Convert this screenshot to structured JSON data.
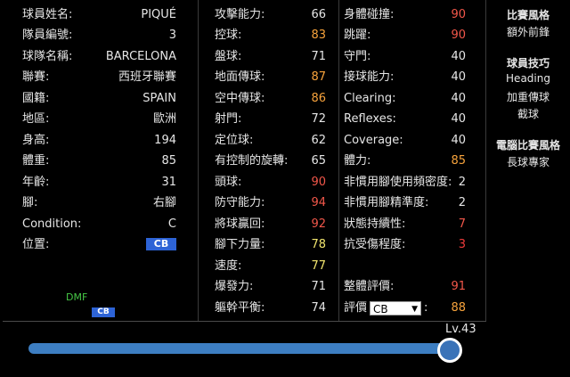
{
  "info": [
    {
      "label": "球員姓名:",
      "value": "PIQUÉ"
    },
    {
      "label": "隊員編號:",
      "value": "3"
    },
    {
      "label": "球隊名稱:",
      "value": "BARCELONA"
    },
    {
      "label": "聯賽:",
      "value": "西班牙聯賽"
    },
    {
      "label": "國籍:",
      "value": "SPAIN"
    },
    {
      "label": "地區:",
      "value": "歐洲"
    },
    {
      "label": "身高:",
      "value": "194"
    },
    {
      "label": "體重:",
      "value": "85"
    },
    {
      "label": "年齡:",
      "value": "31"
    },
    {
      "label": "腳:",
      "value": "右腳"
    },
    {
      "label": "Condition:",
      "value": "C"
    }
  ],
  "position": {
    "label": "位置:",
    "value": "CB"
  },
  "mini_positions": {
    "dmf": "DMF",
    "cb": "CB"
  },
  "stats_mid": [
    {
      "label": "攻擊能力:",
      "value": "66"
    },
    {
      "label": "控球:",
      "value": "83"
    },
    {
      "label": "盤球:",
      "value": "71"
    },
    {
      "label": "地面傳球:",
      "value": "87"
    },
    {
      "label": "空中傳球:",
      "value": "86"
    },
    {
      "label": "射門:",
      "value": "72"
    },
    {
      "label": "定位球:",
      "value": "62"
    },
    {
      "label": "有控制的旋轉:",
      "value": "65"
    },
    {
      "label": "頭球:",
      "value": "90"
    },
    {
      "label": "防守能力:",
      "value": "94"
    },
    {
      "label": "將球贏回:",
      "value": "92"
    },
    {
      "label": "腳下力量:",
      "value": "78"
    },
    {
      "label": "速度:",
      "value": "77"
    },
    {
      "label": "爆發力:",
      "value": "71"
    },
    {
      "label": "軀幹平衡:",
      "value": "74"
    }
  ],
  "stats_right": [
    {
      "label": "身體碰撞:",
      "value": "90"
    },
    {
      "label": "跳躍:",
      "value": "90"
    },
    {
      "label": "守門:",
      "value": "40"
    },
    {
      "label": "接球能力:",
      "value": "40"
    },
    {
      "label": "Clearing:",
      "value": "40"
    },
    {
      "label": "Reflexes:",
      "value": "40"
    },
    {
      "label": "Coverage:",
      "value": "40"
    },
    {
      "label": "體力:",
      "value": "85"
    },
    {
      "label": "非慣用腳使用頻密度:",
      "value": "2"
    },
    {
      "label": "非慣用腳精準度:",
      "value": "2"
    },
    {
      "label": "狀態持續性:",
      "value": "7"
    },
    {
      "label": "抗受傷程度:",
      "value": "3"
    }
  ],
  "overall": {
    "label": "整體評價:",
    "value": "91"
  },
  "rating": {
    "prefix": "評價",
    "selected": "CB",
    "suffix": ":",
    "value": "88"
  },
  "colors": {
    "orange": "#f7a33c",
    "yellow": "#f1e56e",
    "red": "#ef3b3b",
    "badge": "#2d63d6",
    "slider": "#3d7ec2"
  },
  "sidebar": {
    "style_title": "比賽風格",
    "style_value": "額外前鋒",
    "skills_title": "球員技巧",
    "skills": [
      "Heading",
      "加重傳球",
      "截球"
    ],
    "ai_title": "電腦比賽風格",
    "ai_value": "長球專家"
  },
  "level": {
    "label": "Lv.43",
    "fraction": 1.0
  }
}
